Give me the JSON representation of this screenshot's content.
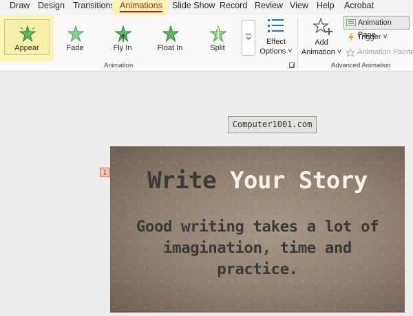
{
  "tabs": [
    {
      "label": "Draw"
    },
    {
      "label": "Design"
    },
    {
      "label": "Transitions"
    },
    {
      "label": "Animations",
      "active": true
    },
    {
      "label": "Slide Show"
    },
    {
      "label": "Record"
    },
    {
      "label": "Review"
    },
    {
      "label": "View"
    },
    {
      "label": "Help"
    },
    {
      "label": "Acrobat"
    }
  ],
  "ribbon": {
    "animation_group_label": "Animation",
    "effects": [
      {
        "label": "Appear",
        "icon": "appear-star-icon",
        "selected": true
      },
      {
        "label": "Fade",
        "icon": "fade-star-icon"
      },
      {
        "label": "Fly In",
        "icon": "fly-in-star-icon"
      },
      {
        "label": "Float In",
        "icon": "float-in-star-icon"
      },
      {
        "label": "Split",
        "icon": "split-star-icon"
      }
    ],
    "effect_options": {
      "line1": "Effect",
      "line2": "Options ˅"
    },
    "advanced_group_label": "Advanced Animation",
    "add_animation": {
      "line1": "Add",
      "line2": "Animation ˅"
    },
    "animation_pane_label": "Animation Pane",
    "trigger_label": "Trigger ˅",
    "animation_painter_label": "Animation Painter"
  },
  "colors": {
    "highlight": "#fbf6b4",
    "active_tab_text": "#b3241f",
    "star_green": "#4caf50"
  },
  "watermark": "Computer1001.com",
  "slide": {
    "title_part1": "Write ",
    "title_part2": "Your Story",
    "body": "Good writing takes a lot of imagination, time and practice.",
    "animation_tag": "1"
  }
}
